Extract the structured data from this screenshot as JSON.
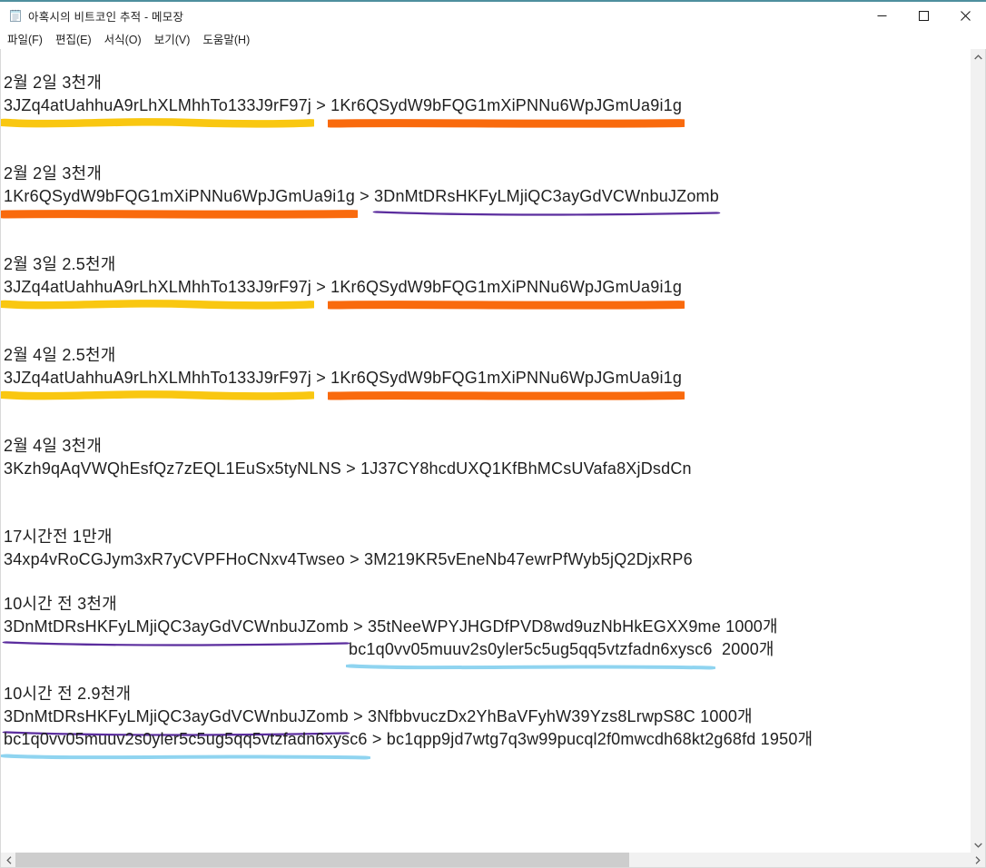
{
  "window": {
    "title": "아혹시의 비트코인 추적 - 메모장"
  },
  "menu": {
    "items": [
      {
        "name": "file",
        "label": "파일(F)"
      },
      {
        "name": "edit",
        "label": "편집(E)"
      },
      {
        "name": "format",
        "label": "서식(O)"
      },
      {
        "name": "view",
        "label": "보기(V)"
      },
      {
        "name": "help",
        "label": "도움말(H)"
      }
    ]
  },
  "colors": {
    "accent_top": "#4e8f9e",
    "marker_yellow": "#f9c711",
    "marker_orange": "#f96a0d",
    "underline_purple": "#5b2d9e",
    "underline_blue": "#8fd4f0",
    "text": "#1f1f1f",
    "scrollbar_track": "#f1f1f1",
    "scrollbar_thumb": "#cdcdcd"
  },
  "document": {
    "entries": [
      {
        "label": "2월 2일 3천개",
        "lines": [
          {
            "indent": false,
            "segments": [
              {
                "kind": "address",
                "text": "3JZq4atUahhuA9rLhXLMhhTo133J9rF97j",
                "hl": "yellow"
              },
              {
                "kind": "arrow",
                "text": " > "
              },
              {
                "kind": "address",
                "text": "1Kr6QSydW9bFQG1mXiPNNu6WpJGmUa9i1g",
                "hl": "orange"
              }
            ]
          }
        ]
      },
      {
        "label": "2월 2일 3천개",
        "lines": [
          {
            "indent": false,
            "segments": [
              {
                "kind": "address",
                "text": "1Kr6QSydW9bFQG1mXiPNNu6WpJGmUa9i1g",
                "hl": "orange"
              },
              {
                "kind": "arrow",
                "text": " > "
              },
              {
                "kind": "address",
                "text": "3DnMtDRsHKFyLMjiQC3ayGdVCWnbuJZomb",
                "hl": "purple"
              }
            ]
          }
        ]
      },
      {
        "label": "2월 3일 2.5천개",
        "lines": [
          {
            "indent": false,
            "segments": [
              {
                "kind": "address",
                "text": "3JZq4atUahhuA9rLhXLMhhTo133J9rF97j",
                "hl": "yellow"
              },
              {
                "kind": "arrow",
                "text": " > "
              },
              {
                "kind": "address",
                "text": "1Kr6QSydW9bFQG1mXiPNNu6WpJGmUa9i1g",
                "hl": "orange"
              }
            ]
          }
        ]
      },
      {
        "label": "2월 4일 2.5천개",
        "lines": [
          {
            "indent": false,
            "segments": [
              {
                "kind": "address",
                "text": "3JZq4atUahhuA9rLhXLMhhTo133J9rF97j",
                "hl": "yellow"
              },
              {
                "kind": "arrow",
                "text": " > "
              },
              {
                "kind": "address",
                "text": "1Kr6QSydW9bFQG1mXiPNNu6WpJGmUa9i1g",
                "hl": "orange"
              }
            ]
          }
        ]
      },
      {
        "label": "2월 4일 3천개",
        "lines": [
          {
            "indent": false,
            "segments": [
              {
                "kind": "address",
                "text": "3Kzh9qAqVWQhEsfQz7zEQL1EuSx5tyNLNS",
                "hl": null
              },
              {
                "kind": "arrow",
                "text": " > "
              },
              {
                "kind": "address",
                "text": "1J37CY8hcdUXQ1KfBhMCsUVafa8XjDsdCn",
                "hl": null
              }
            ]
          }
        ]
      },
      {
        "label": "17시간전 1만개",
        "lines": [
          {
            "indent": false,
            "segments": [
              {
                "kind": "address",
                "text": "34xp4vRoCGJym3xR7yCVPFHoCNxv4Twseo",
                "hl": null
              },
              {
                "kind": "arrow",
                "text": " > "
              },
              {
                "kind": "address",
                "text": "3M219KR5vEneNb47ewrPfWyb5jQ2DjxRP6",
                "hl": null
              }
            ]
          }
        ]
      },
      {
        "label": "10시간 전 3천개",
        "lines": [
          {
            "indent": false,
            "segments": [
              {
                "kind": "address",
                "text": "3DnMtDRsHKFyLMjiQC3ayGdVCWnbuJZomb",
                "hl": "purple"
              },
              {
                "kind": "arrow",
                "text": " > "
              },
              {
                "kind": "address",
                "text": "35tNeeWPYJHGDfPVD8wd9uzNbHkEGXX9me",
                "hl": null
              },
              {
                "kind": "amount",
                "text": " 1000개"
              }
            ]
          },
          {
            "indent": true,
            "segments": [
              {
                "kind": "address",
                "text": "bc1q0vv05muuv2s0yler5c5ug5qq5vtzfadn6xysc6",
                "hl": "blue"
              },
              {
                "kind": "amount",
                "text": "  2000개"
              }
            ]
          }
        ]
      },
      {
        "label": "10시간 전 2.9천개",
        "lines": [
          {
            "indent": false,
            "segments": [
              {
                "kind": "address",
                "text": "3DnMtDRsHKFyLMjiQC3ayGdVCWnbuJZomb",
                "hl": "purple"
              },
              {
                "kind": "arrow",
                "text": " > "
              },
              {
                "kind": "address",
                "text": "3NfbbvuczDx2YhBaVFyhW39Yzs8LrwpS8C",
                "hl": null
              },
              {
                "kind": "amount",
                "text": " 1000개"
              }
            ]
          },
          {
            "indent": false,
            "segments": [
              {
                "kind": "address",
                "text": "bc1q0vv05muuv2s0yler5c5ug5qq5vtzfadn6xysc6",
                "hl": "blue"
              },
              {
                "kind": "arrow",
                "text": " > "
              },
              {
                "kind": "address",
                "text": "bc1qpp9jd7wtg7q3w99pucql2f0mwcdh68kt2g68fd",
                "hl": null
              },
              {
                "kind": "amount",
                "text": " 1950개"
              }
            ]
          }
        ]
      }
    ]
  }
}
